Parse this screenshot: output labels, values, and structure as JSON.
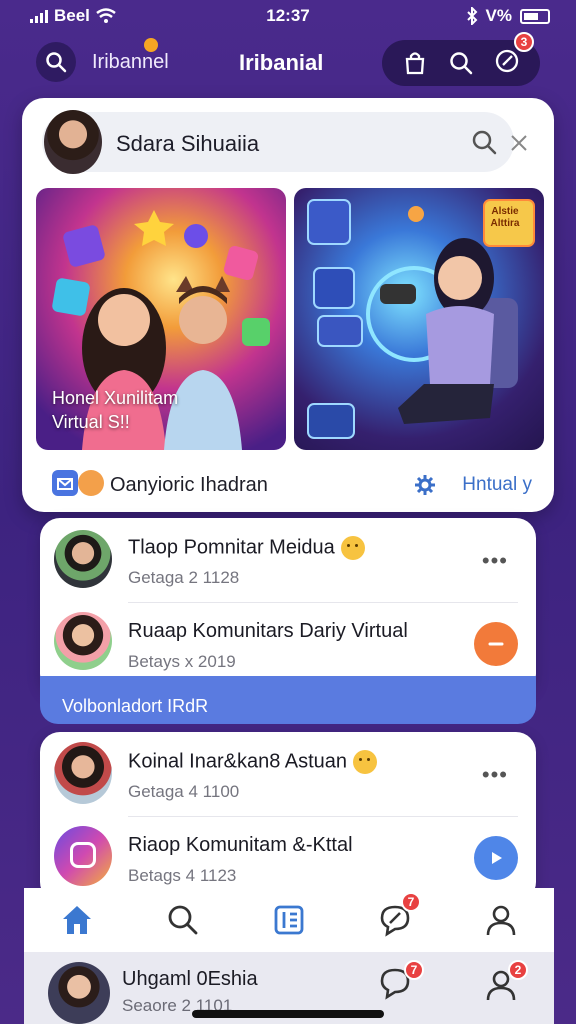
{
  "status_bar": {
    "carrier": "Beel",
    "time": "12:37",
    "battery": "V%"
  },
  "header": {
    "brand": "Iribannel",
    "title": "Iribanial",
    "notification_count": "3"
  },
  "search": {
    "value": "Sdara Sihuaiia"
  },
  "featured": {
    "tile1_caption_line1": "Honel Xunilitam",
    "tile1_caption_line2": "Virtual S!!",
    "tile2_sign": "Alstie Alttira",
    "footer_label": "Oanyioric Ihadran",
    "footer_link": "Hntual y"
  },
  "group1": {
    "rows": [
      {
        "title": "Tlaop Pomnitar Meidua",
        "sub": "Getaga 2 1128"
      },
      {
        "title": "Ruaap Komunitars Dariy Virtual",
        "sub": "Betays x 2019"
      }
    ],
    "strip": "Volbonladort IRdR"
  },
  "group2": {
    "rows": [
      {
        "title": "Koinal Inar&kan8 Astuan",
        "sub": "Getaga 4 1100"
      },
      {
        "title": "Riaop Komunitam &-Kttal",
        "sub": "Betags 4 1123"
      }
    ]
  },
  "nav": {
    "chat_badge": "7"
  },
  "account": {
    "name": "Uhgaml 0Eshia",
    "sub": "Seaore 2 1101",
    "chat_badge": "7",
    "profile_badge": "2"
  },
  "colors": {
    "brand_purple": "#4a2a8c",
    "accent_blue": "#3b6fc8",
    "orange": "#f27a3a",
    "badge_red": "#e84141"
  }
}
